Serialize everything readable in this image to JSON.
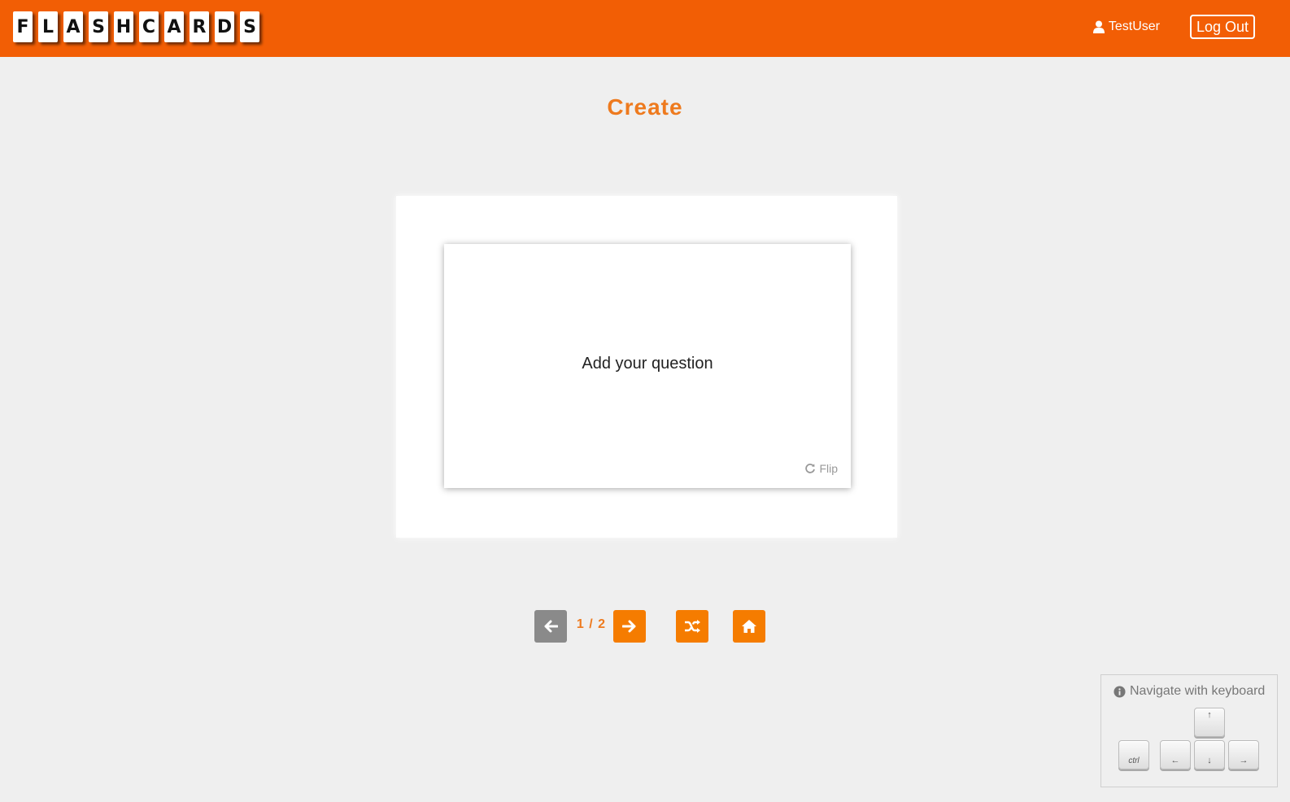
{
  "header": {
    "logo_letters": [
      "F",
      "L",
      "A",
      "S",
      "H",
      "C",
      "A",
      "R",
      "D",
      "S"
    ],
    "username": "TestUser",
    "logout_label": "Log Out",
    "user_icon": "user-icon",
    "background_color": "#f25e05"
  },
  "page": {
    "title": "Create"
  },
  "card": {
    "question": "Add your question",
    "flip_label": "Flip",
    "flip_icon": "refresh-icon"
  },
  "navigation": {
    "counter": "1 / 2",
    "prev_icon": "arrow-left-icon",
    "next_icon": "arrow-right-icon",
    "shuffle_icon": "shuffle-icon",
    "home_icon": "home-icon",
    "accent_color": "#f57c00",
    "disabled_color": "#8a8a8a"
  },
  "keyboard_hint": {
    "label": "Navigate with keyboard",
    "info_icon": "info-icon",
    "keys": {
      "ctrl": "ctrl",
      "up": "↑",
      "left": "←",
      "down": "↓",
      "right": "→"
    }
  }
}
